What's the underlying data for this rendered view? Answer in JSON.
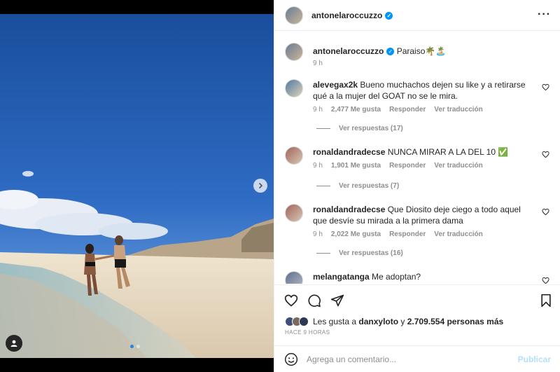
{
  "post": {
    "username": "antonelaroccuzzo",
    "caption": "Paraiso🌴🏝️",
    "caption_time": "9 h",
    "more_icon": "more-horizontal-icon"
  },
  "media": {
    "carousel_dots": 2,
    "active_dot": 0
  },
  "comments": [
    {
      "username": "alevegax2k",
      "text": "Bueno muchachos dejen su like y a retirarse qué a la mujer del GOAT no se le mira.",
      "time": "9 h",
      "likes": "2,477 Me gusta",
      "reply": "Responder",
      "translate": "Ver traducción",
      "replies": "Ver respuestas (17)"
    },
    {
      "username": "ronaldandradecse",
      "text": "NUNCA MIRAR A LA DEL 10 ✅",
      "time": "9 h",
      "likes": "1,901 Me gusta",
      "reply": "Responder",
      "translate": "Ver traducción",
      "replies": "Ver respuestas (7)"
    },
    {
      "username": "ronaldandradecse",
      "text": "Que Diosito deje ciego a todo aquel que desvíe su mirada a la primera dama",
      "time": "9 h",
      "likes": "2,022 Me gusta",
      "reply": "Responder",
      "translate": "Ver traducción",
      "replies": "Ver respuestas (16)"
    },
    {
      "username": "melangatanga",
      "text": "Me adoptan?"
    }
  ],
  "likes_line": {
    "prefix": "Les gusta a",
    "user": "danxyloto",
    "middle": "y",
    "count": "2.709.554 personas más"
  },
  "posted_time": "HACE 9 HORAS",
  "composer": {
    "placeholder": "Agrega un comentario...",
    "publish": "Publicar"
  },
  "colors": {
    "verified": "#0095f6",
    "publish_disabled": "#b2dffc",
    "muted": "#8e8e8e"
  }
}
